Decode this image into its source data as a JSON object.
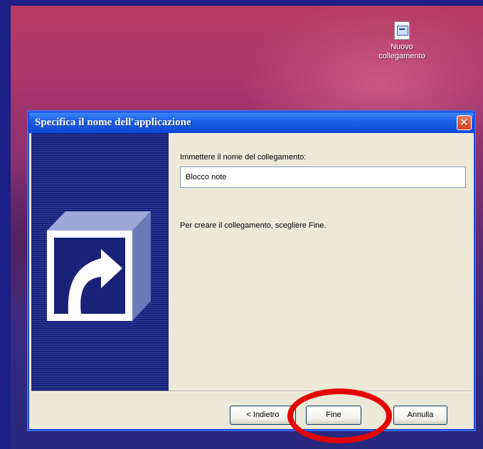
{
  "desktop": {
    "shortcut_icon": "shortcut-file-icon",
    "shortcut_line1": "Nuovo",
    "shortcut_line2": "collegamento"
  },
  "dialog": {
    "title": "Specifica il nome dell'applicazione",
    "close_icon": "close-icon",
    "prompt_label": "Immettere il nome del collegamento:",
    "name_value": "Blocco note",
    "finish_hint": "Per creare il collegamento, scegliere Fine.",
    "panel_icon": "shortcut-arrow-icon",
    "buttons": {
      "back": "< Indietro",
      "finish": "Fine",
      "cancel": "Annulla"
    }
  },
  "annotation": {
    "highlight_color": "#e60000",
    "highlights": "finish-button"
  }
}
